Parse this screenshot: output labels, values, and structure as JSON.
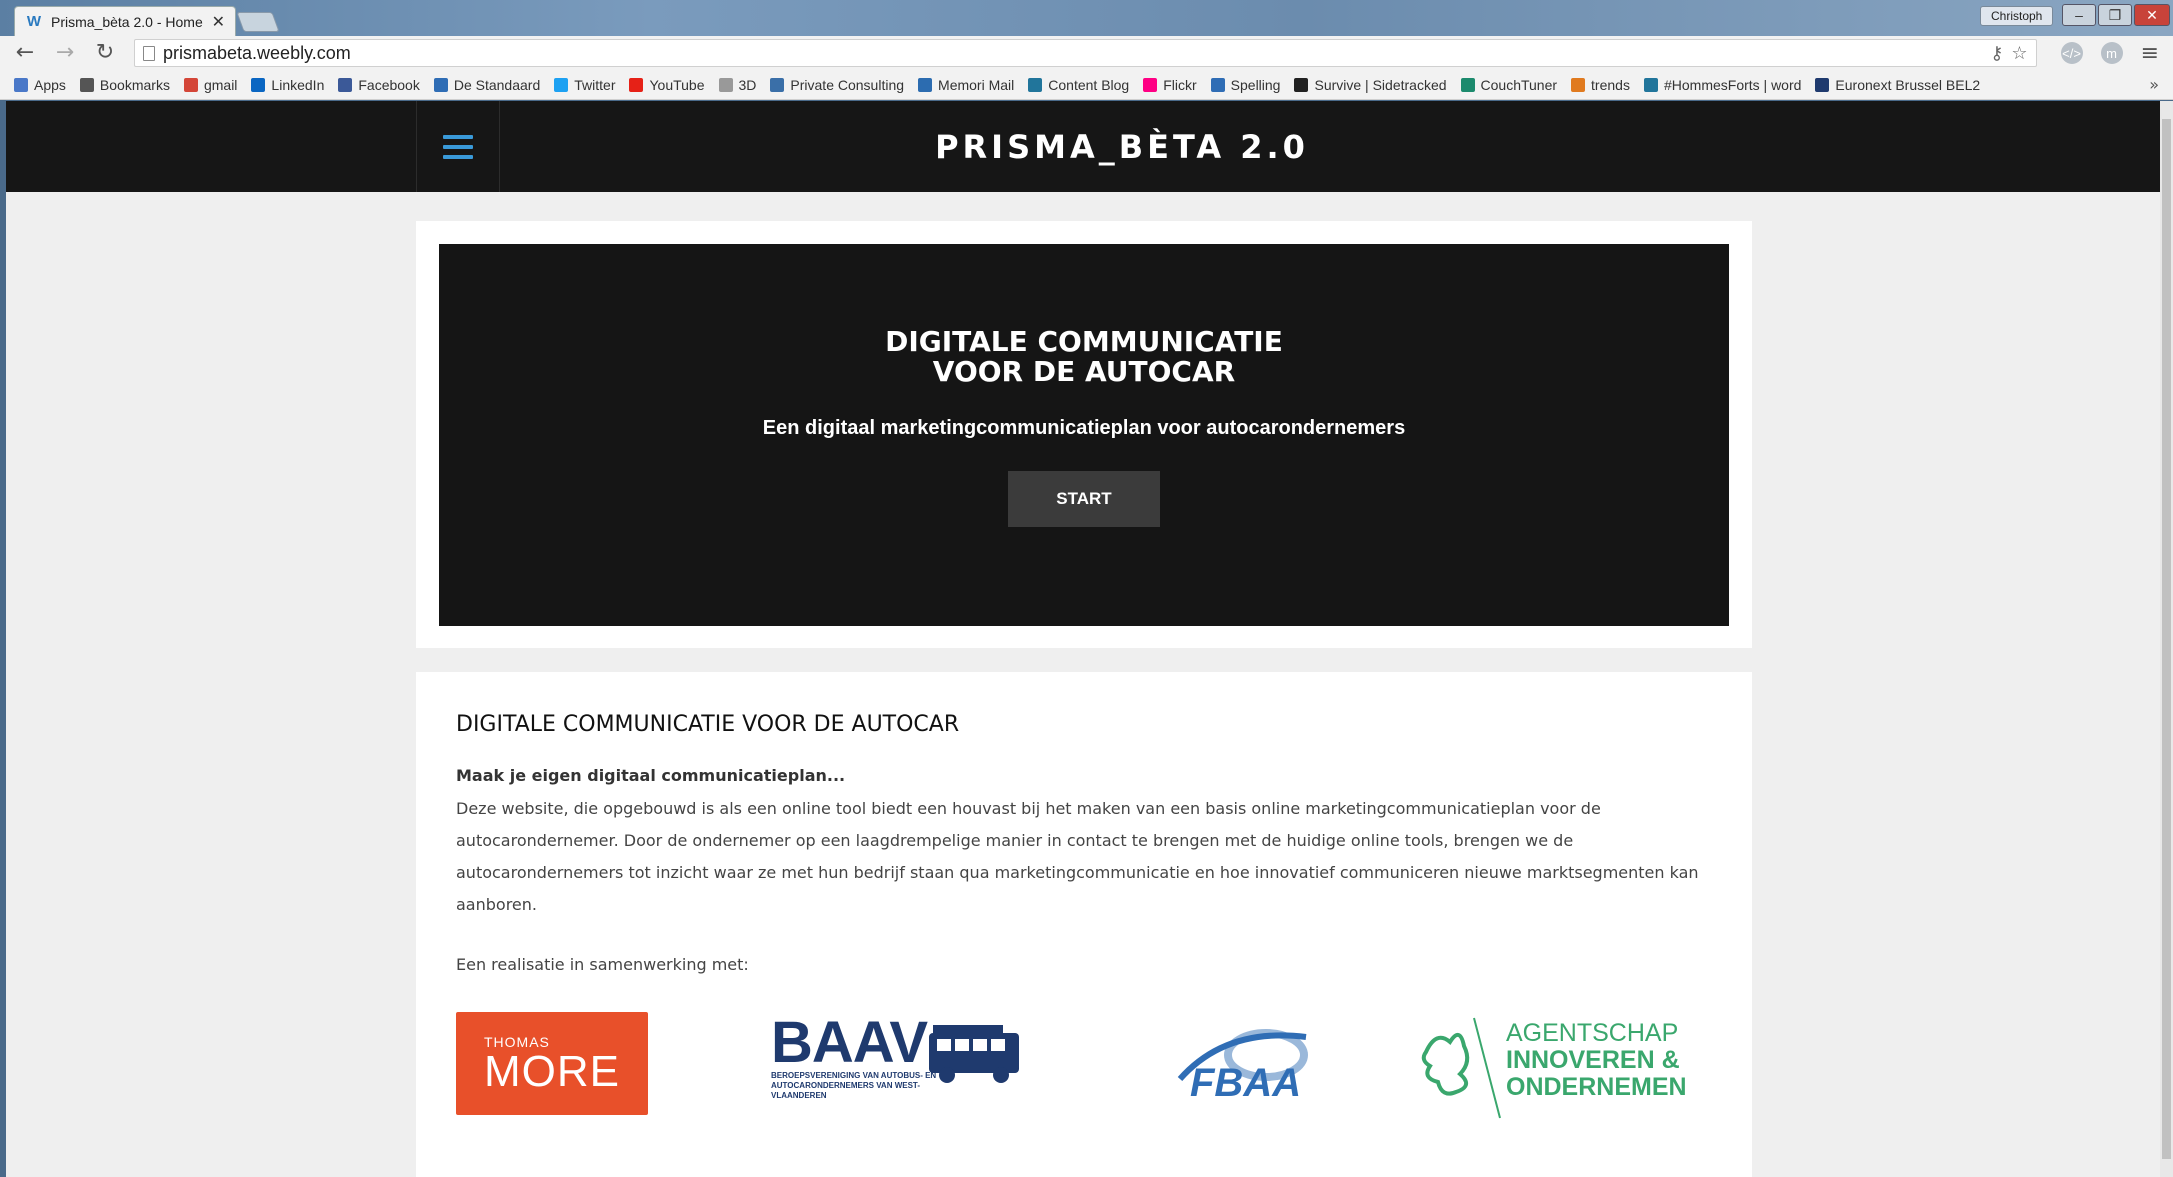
{
  "browser": {
    "tab_title": "Prisma_bèta 2.0 - Home",
    "tab_favicon": "W",
    "user_name": "Christoph",
    "url": "prismabeta.weebly.com",
    "bookmarks": [
      {
        "label": "Apps",
        "icon": "apps-grid-icon",
        "color": "#4a78c8"
      },
      {
        "label": "Bookmarks",
        "icon": "star-icon",
        "color": "#555555"
      },
      {
        "label": "gmail",
        "icon": "gmail-icon",
        "color": "#d44638"
      },
      {
        "label": "LinkedIn",
        "icon": "linkedin-icon",
        "color": "#0a66c2"
      },
      {
        "label": "Facebook",
        "icon": "facebook-icon",
        "color": "#3b5998"
      },
      {
        "label": "De Standaard",
        "icon": "standaard-icon",
        "color": "#2f6db5"
      },
      {
        "label": "Twitter",
        "icon": "twitter-icon",
        "color": "#1da1f2"
      },
      {
        "label": "YouTube",
        "icon": "youtube-icon",
        "color": "#e62117"
      },
      {
        "label": "3D",
        "icon": "page-icon",
        "color": "#999999"
      },
      {
        "label": "Private Consulting",
        "icon": "consulting-icon",
        "color": "#3a6fa8"
      },
      {
        "label": "Memori Mail",
        "icon": "mail-icon",
        "color": "#2c6cb0"
      },
      {
        "label": "Content Blog",
        "icon": "wordpress-icon",
        "color": "#21759b"
      },
      {
        "label": "Flickr",
        "icon": "flickr-icon",
        "color": "#ff0084"
      },
      {
        "label": "Spelling",
        "icon": "dots-icon",
        "color": "#2f6db5"
      },
      {
        "label": "Survive | Sidetracked",
        "icon": "circle-icon",
        "color": "#222222"
      },
      {
        "label": "CouchTuner",
        "icon": "tv-icon",
        "color": "#1c8a6d"
      },
      {
        "label": "trends",
        "icon": "rss-icon",
        "color": "#e07a1f"
      },
      {
        "label": "#HommesForts | word",
        "icon": "wordpress-icon",
        "color": "#21759b"
      },
      {
        "label": "Euronext Brussel BEL2",
        "icon": "t-icon",
        "color": "#1f3a6e"
      }
    ]
  },
  "site": {
    "title": "PRISMA_BÈTA 2.0",
    "hero": {
      "title": "DIGITALE COMMUNICATIE\nVOOR DE AUTOCAR",
      "subtitle": "Een digitaal marketingcommunicatieplan voor autocarondernemers",
      "button": "START"
    },
    "content": {
      "heading": "DIGITALE COMMUNICATIE VOOR DE AUTOCAR",
      "lead": "Maak je eigen digitaal communicatieplan...",
      "body": "Deze website, die opgebouwd is als een online tool biedt een houvast bij het maken van een basis online marketingcommunicatieplan voor de autocarondernemer. Door de ondernemer op een laagdrempelige manier in contact te brengen met de huidige online tools, brengen we de autocarondernemers tot inzicht waar ze met hun bedrijf staan qua marketingcommunicatie en hoe innovatief communiceren nieuwe marktsegmenten kan aanboren.",
      "partners_label": "Een realisatie in samenwerking met:"
    },
    "partners": {
      "thomas_more": {
        "small": "THOMAS",
        "big": "MORE",
        "color": "#e8502a"
      },
      "baav": {
        "word": "BAAV",
        "sub": "BEROEPSVERENIGING VAN AUTOBUS- EN\nAUTOCARONDERNEMERS VAN WEST-VLAANDEREN",
        "color": "#1f3a6e"
      },
      "fbaa": {
        "word": "FBAA",
        "color": "#2f6db5"
      },
      "agentschap": {
        "line1": "AGENTSCHAP",
        "line2": "INNOVEREN &",
        "line3": "ONDERNEMEN",
        "color": "#3aa76d"
      }
    }
  }
}
